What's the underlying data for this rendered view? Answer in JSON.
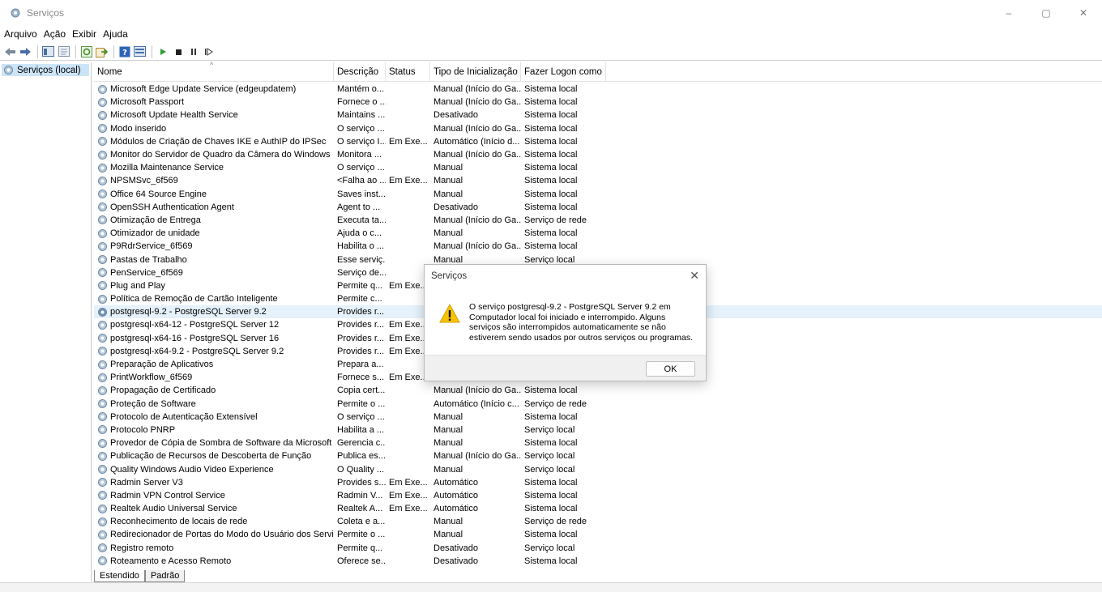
{
  "window": {
    "title": "Serviços",
    "icon": "gear-services-icon",
    "controls": {
      "minimize": "–",
      "maximize": "▢",
      "close": "✕"
    }
  },
  "menu": [
    "Arquivo",
    "Ação",
    "Exibir",
    "Ajuda"
  ],
  "toolbar": {
    "icons": [
      "back-arrow-icon",
      "forward-arrow-icon",
      "console-tree-icon",
      "properties-icon",
      "refresh-icon",
      "export-icon",
      "help-icon",
      "view-icon",
      "play-icon",
      "stop-icon",
      "pause-icon",
      "resume-icon"
    ]
  },
  "tree": {
    "label": "Serviços (local)"
  },
  "columns": {
    "name": "Nome",
    "desc": "Descrição",
    "status": "Status",
    "type": "Tipo de Inicialização",
    "logon": "Fazer Logon como"
  },
  "rows": [
    [
      "Microsoft Edge Update Service (edgeupdatem)",
      "Mantém o...",
      "",
      "Manual (Início do Ga...",
      "Sistema local"
    ],
    [
      "Microsoft Passport",
      "Fornece o ...",
      "",
      "Manual (Início do Ga...",
      "Sistema local"
    ],
    [
      "Microsoft Update Health Service",
      "Maintains ...",
      "",
      "Desativado",
      "Sistema local"
    ],
    [
      "Modo inserido",
      "O serviço ...",
      "",
      "Manual (Início do Ga...",
      "Sistema local"
    ],
    [
      "Módulos de Criação de Chaves IKE e AuthIP do IPSec",
      "O serviço I...",
      "Em Exe...",
      "Automático (Início d...",
      "Sistema local"
    ],
    [
      "Monitor do Servidor de Quadro da Câmera do Windows",
      "Monitora ...",
      "",
      "Manual (Início do Ga...",
      "Sistema local"
    ],
    [
      "Mozilla Maintenance Service",
      "O serviço ...",
      "",
      "Manual",
      "Sistema local"
    ],
    [
      "NPSMSvc_6f569",
      "<Falha ao ...",
      "Em Exe...",
      "Manual",
      "Sistema local"
    ],
    [
      "Office 64 Source Engine",
      "Saves inst...",
      "",
      "Manual",
      "Sistema local"
    ],
    [
      "OpenSSH Authentication Agent",
      "Agent to ...",
      "",
      "Desativado",
      "Sistema local"
    ],
    [
      "Otimização de Entrega",
      "Executa ta...",
      "",
      "Manual (Início do Ga...",
      "Serviço de rede"
    ],
    [
      "Otimizador de unidade",
      "Ajuda o c...",
      "",
      "Manual",
      "Sistema local"
    ],
    [
      "P9RdrService_6f569",
      "Habilita o ...",
      "",
      "Manual (Início do Ga...",
      "Sistema local"
    ],
    [
      "Pastas de Trabalho",
      "Esse serviç...",
      "",
      "Manual",
      "Serviço local"
    ],
    [
      "PenService_6f569",
      "Serviço de...",
      "",
      "",
      ""
    ],
    [
      "Plug and Play",
      "Permite q...",
      "Em Exe...",
      "",
      ""
    ],
    [
      "Política de Remoção de Cartão Inteligente",
      "Permite c...",
      "",
      "",
      ""
    ],
    [
      "postgresql-9.2 - PostgreSQL Server 9.2",
      "Provides r...",
      "",
      "",
      ""
    ],
    [
      "postgresql-x64-12 - PostgreSQL Server 12",
      "Provides r...",
      "Em Exe...",
      "",
      ""
    ],
    [
      "postgresql-x64-16 - PostgreSQL Server 16",
      "Provides r...",
      "Em Exe...",
      "",
      ""
    ],
    [
      "postgresql-x64-9.2 - PostgreSQL Server 9.2",
      "Provides r...",
      "Em Exe...",
      "",
      ""
    ],
    [
      "Preparação de Aplicativos",
      "Prepara a...",
      "",
      "",
      ""
    ],
    [
      "PrintWorkflow_6f569",
      "Fornece s...",
      "Em Exe...",
      "",
      ""
    ],
    [
      "Propagação de Certificado",
      "Copia cert...",
      "",
      "Manual (Início do Ga...",
      "Sistema local"
    ],
    [
      "Proteção de Software",
      "Permite o ...",
      "",
      "Automático (Início c...",
      "Serviço de rede"
    ],
    [
      "Protocolo de Autenticação Extensível",
      "O serviço ...",
      "",
      "Manual",
      "Sistema local"
    ],
    [
      "Protocolo PNRP",
      "Habilita a ...",
      "",
      "Manual",
      "Serviço local"
    ],
    [
      "Provedor de Cópia de Sombra de Software da Microsoft",
      "Gerencia c...",
      "",
      "Manual",
      "Sistema local"
    ],
    [
      "Publicação de Recursos de Descoberta de Função",
      "Publica es...",
      "",
      "Manual (Início do Ga...",
      "Serviço local"
    ],
    [
      "Quality Windows Audio Video Experience",
      "O Quality ...",
      "",
      "Manual",
      "Serviço local"
    ],
    [
      "Radmin Server V3",
      "Provides s...",
      "Em Exe...",
      "Automático",
      "Sistema local"
    ],
    [
      "Radmin VPN Control Service",
      "Radmin V...",
      "Em Exe...",
      "Automático",
      "Sistema local"
    ],
    [
      "Realtek Audio Universal Service",
      "Realtek A...",
      "Em Exe...",
      "Automático",
      "Sistema local"
    ],
    [
      "Reconhecimento de locais de rede",
      "Coleta e a...",
      "",
      "Manual",
      "Serviço de rede"
    ],
    [
      "Redirecionador de Portas do Modo do Usuário dos Serviços...",
      "Permite o ...",
      "",
      "Manual",
      "Sistema local"
    ],
    [
      "Registro remoto",
      "Permite q...",
      "",
      "Desativado",
      "Serviço local"
    ],
    [
      "Roteamento e Acesso Remoto",
      "Oferece se...",
      "",
      "Desativado",
      "Sistema local"
    ]
  ],
  "selected_row": 17,
  "tabs": [
    "Estendido",
    "Padrão"
  ],
  "dialog": {
    "title": "Serviços",
    "close": "✕",
    "message": "O serviço postgresql-9.2 - PostgreSQL Server 9.2 em Computador local foi iniciado e interrompido. Alguns serviços são interrompidos automaticamente se não estiverem sendo usados por outros serviços ou programas.",
    "ok": "OK",
    "icon": "warning-icon"
  },
  "colors": {
    "selected": "#e5f1fb",
    "tree_selected": "#cce4f7",
    "warning": "#f8c300"
  }
}
